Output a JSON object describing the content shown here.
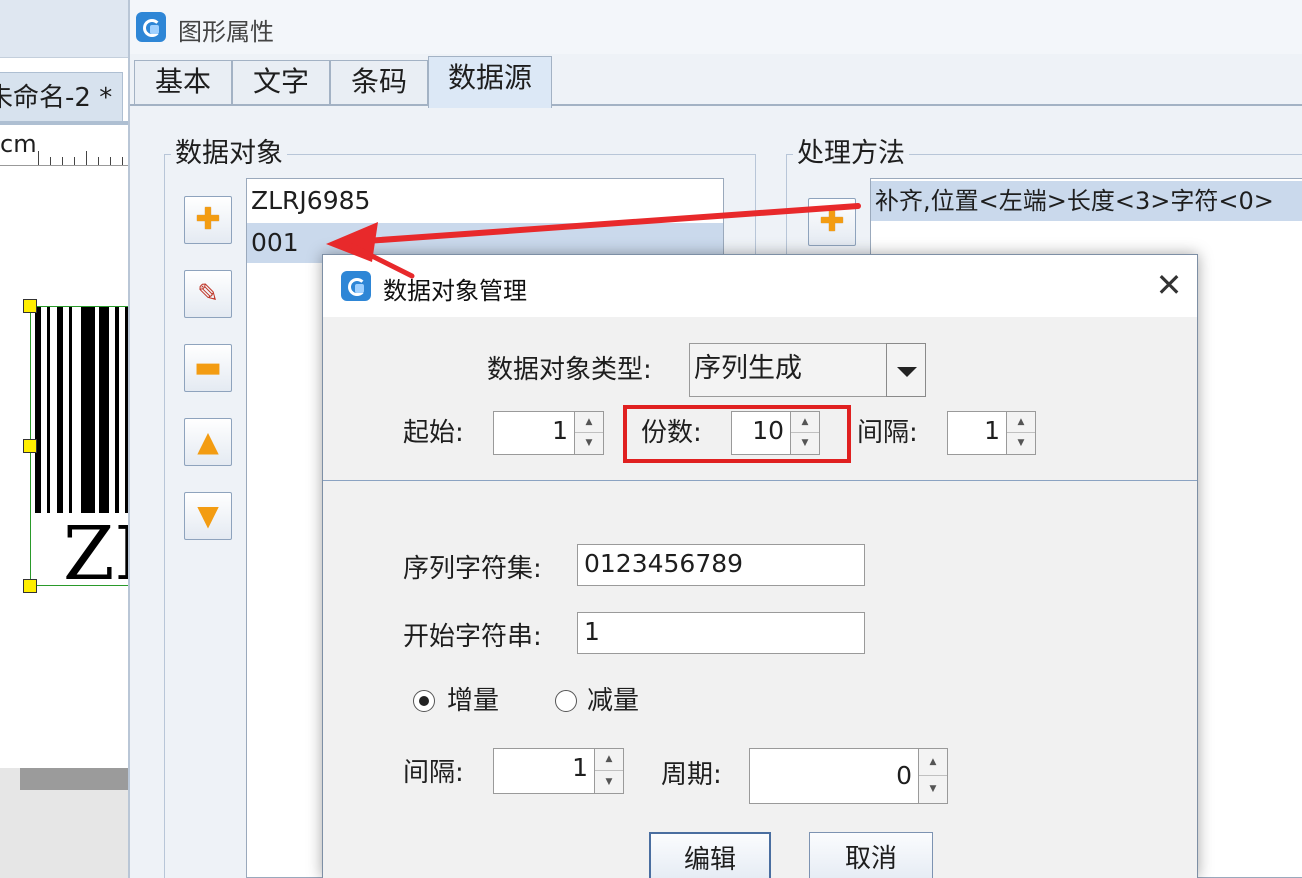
{
  "background_editor": {
    "tab_label": "未命名-2 *",
    "ruler_unit": "cm",
    "barcode_text": "ZL"
  },
  "properties_dialog": {
    "title": "图形属性",
    "tabs": [
      "基本",
      "文字",
      "条码",
      "数据源"
    ],
    "active_tab": "数据源",
    "data_objects": {
      "group_title": "数据对象",
      "items": [
        "ZLRJ6985",
        "001"
      ],
      "selected": "001"
    },
    "processing": {
      "group_title": "处理方法",
      "items": [
        "补齐,位置<左端>长度<3>字符<0>"
      ]
    }
  },
  "data_object_dialog": {
    "title": "数据对象管理",
    "close_glyph": "✕",
    "type_label": "数据对象类型:",
    "type_value": "序列生成",
    "start_label": "起始:",
    "start_value": "1",
    "copies_label": "份数:",
    "copies_value": "10",
    "interval_label": "间隔:",
    "interval_value": "1",
    "charset_label": "序列字符集:",
    "charset_value": "0123456789",
    "start_string_label": "开始字符串:",
    "start_string_value": "1",
    "increment_label": "增量",
    "decrement_label": "减量",
    "mode_selected": "增量",
    "step_label": "间隔:",
    "step_value": "1",
    "period_label": "周期:",
    "period_value": "0",
    "edit_button": "编辑",
    "cancel_button": "取消"
  },
  "annotation": {
    "highlight_color": "#e02020",
    "arrow_color": "#e8292b"
  }
}
